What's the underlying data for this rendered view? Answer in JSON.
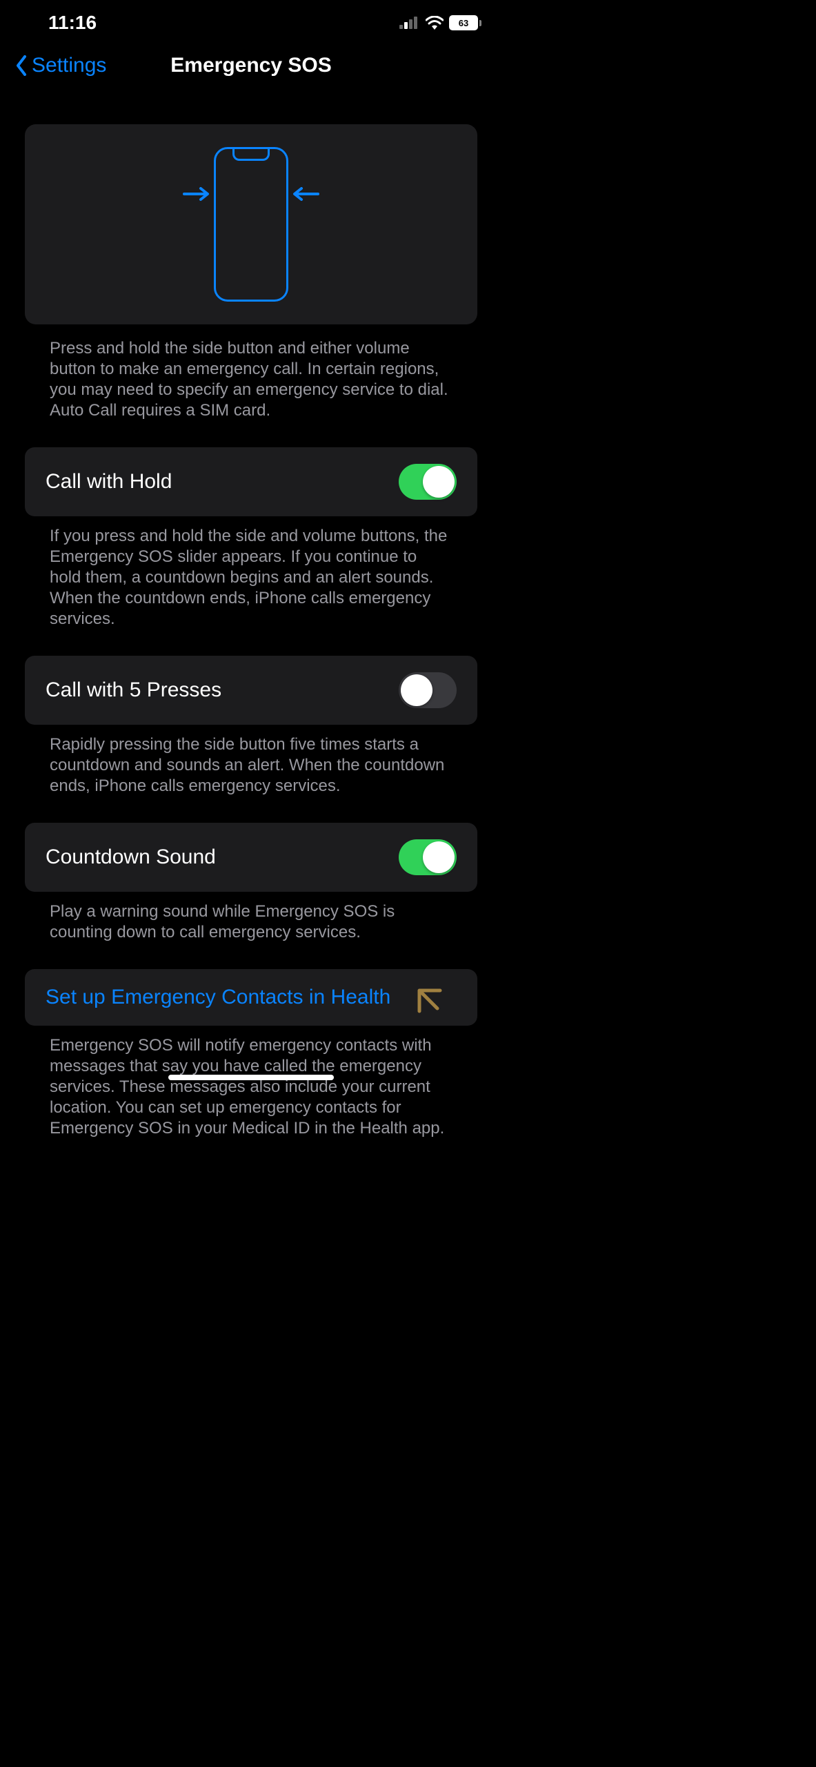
{
  "status": {
    "time": "11:16",
    "battery_percent": "63"
  },
  "nav": {
    "back_label": "Settings",
    "title": "Emergency SOS"
  },
  "hero": {
    "description": "Press and hold the side button and either volume button to make an emergency call. In certain regions, you may need to specify an emergency service to dial. Auto Call requires a SIM card."
  },
  "settings": {
    "call_with_hold": {
      "label": "Call with Hold",
      "enabled": true,
      "description": "If you press and hold the side and volume buttons, the Emergency SOS slider appears. If you continue to hold them, a countdown begins and an alert sounds. When the countdown ends, iPhone calls emergency services."
    },
    "call_with_5_presses": {
      "label": "Call with 5 Presses",
      "enabled": false,
      "description": "Rapidly pressing the side button five times starts a countdown and sounds an alert. When the countdown ends, iPhone calls emergency services."
    },
    "countdown_sound": {
      "label": "Countdown Sound",
      "enabled": true,
      "description": "Play a warning sound while Emergency SOS is counting down to call emergency services."
    },
    "emergency_contacts": {
      "label": "Set up Emergency Contacts in Health",
      "description": "Emergency SOS will notify emergency contacts with messages that say you have called the emergency services. These messages also include your current location. You can set up emergency contacts for Emergency SOS in your Medical ID in the Health app."
    }
  }
}
